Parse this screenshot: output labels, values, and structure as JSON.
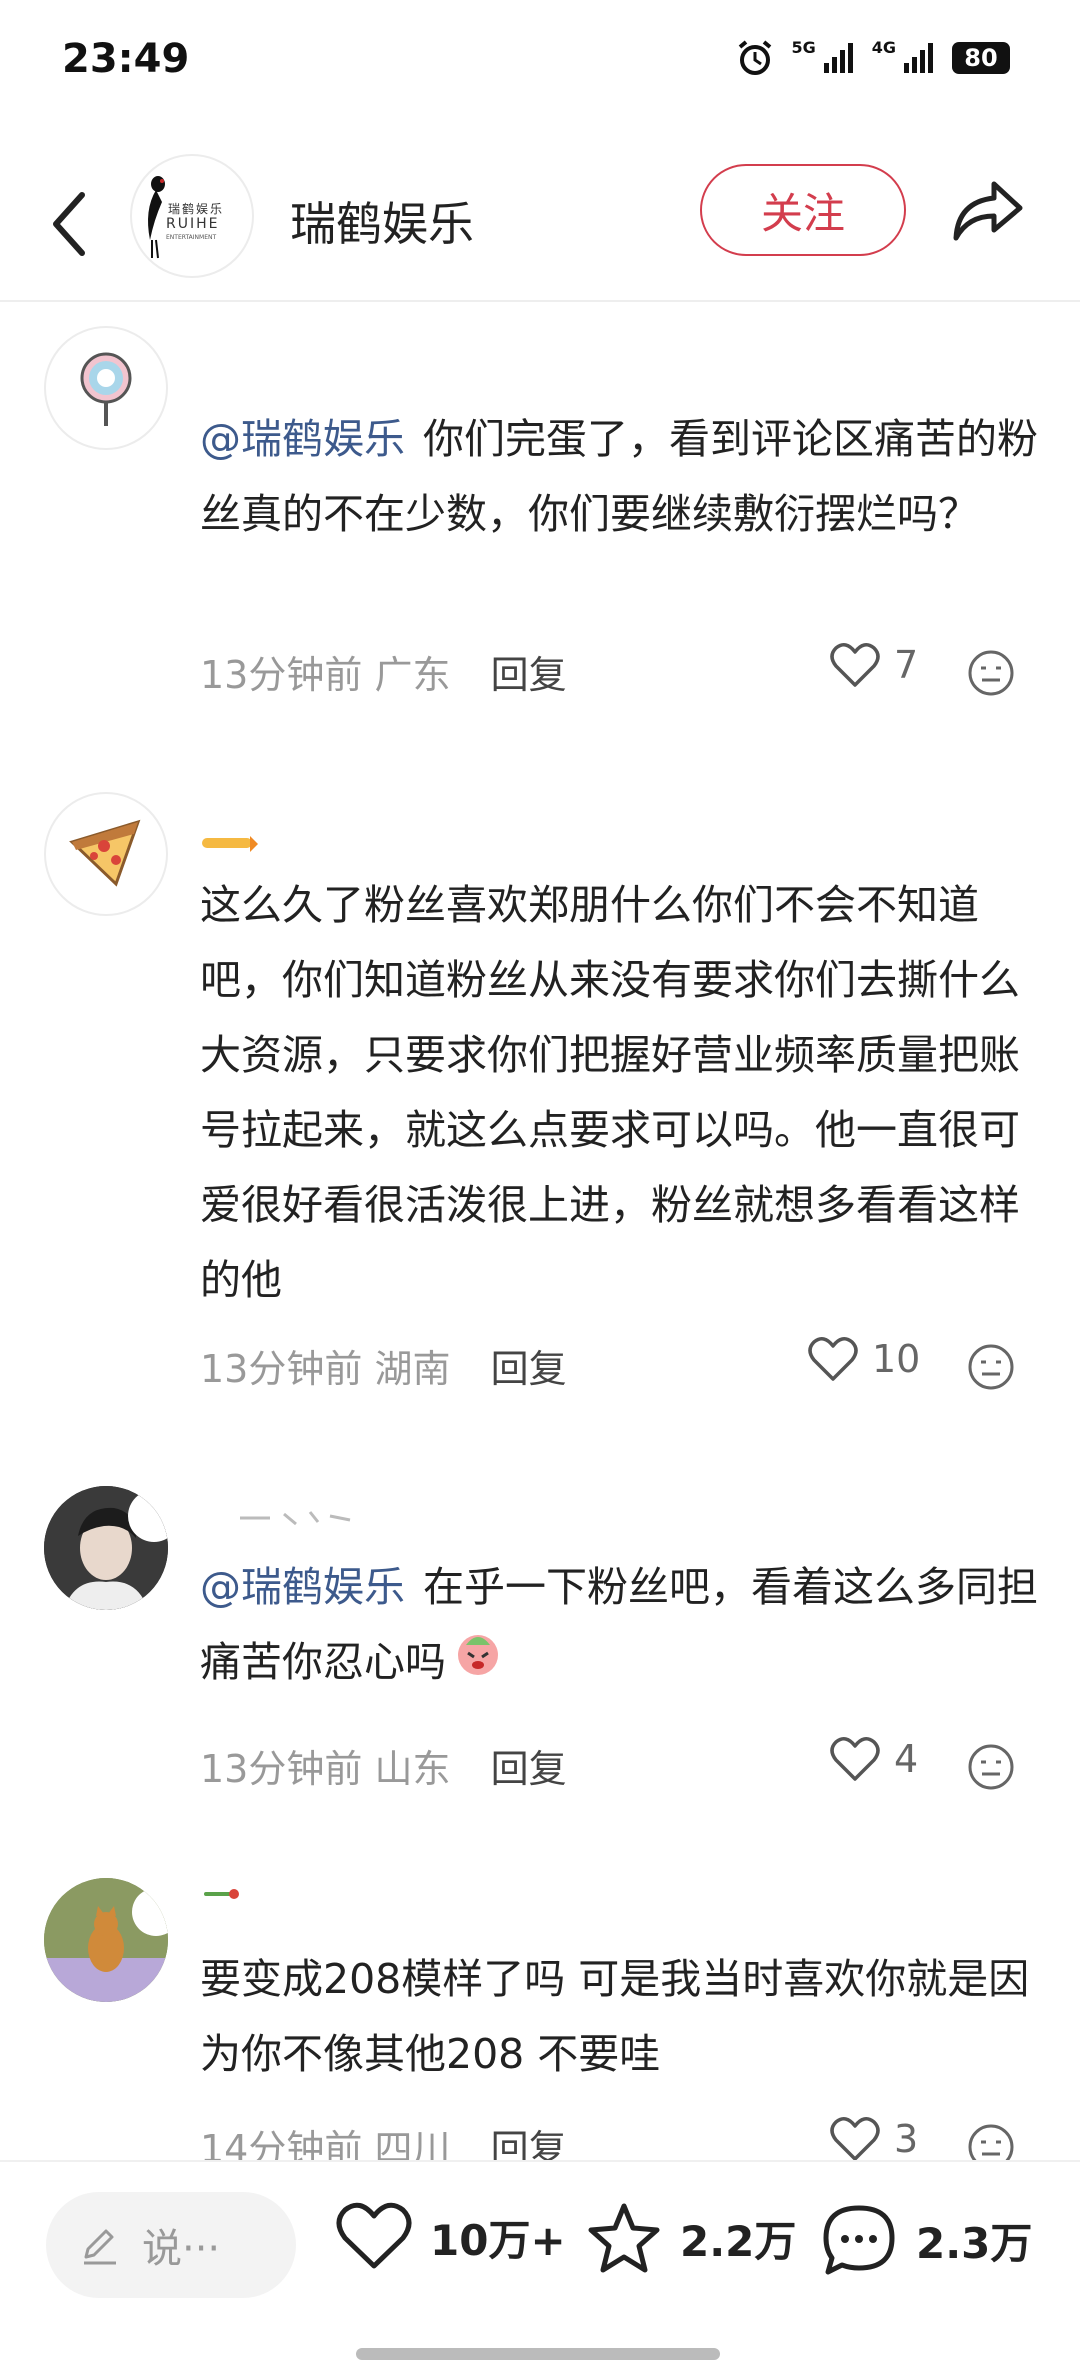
{
  "status_bar": {
    "time": "23:49",
    "net_5g": "5G",
    "net_4g": "4G",
    "battery": "80"
  },
  "header": {
    "back_icon": "chevron-left-icon",
    "logo_cn": "瑞鹤娱乐",
    "logo_en": "RUIHE",
    "logo_en_sub": "ENTERTAINMENT",
    "title": "瑞鹤娱乐",
    "follow_label": "关注",
    "share_icon": "share-arrow-icon"
  },
  "comments": [
    {
      "mention": "@瑞鹤娱乐",
      "text": "你们完蛋了，看到评论区痛苦的粉丝真的不在少数，你们要继续敷衍摆烂吗？",
      "time": "13分钟前",
      "location": "广东",
      "reply": "回复",
      "likes": "7"
    },
    {
      "mention": "",
      "text": "这么久了粉丝喜欢郑朋什么你们不会不知道吧，你们知道粉丝从来没有要求你们去撕什么大资源，只要求你们把握好营业频率质量把账号拉起来，就这么点要求可以吗。他一直很可爱很好看很活泼很上进，粉丝就想多看看这样的他",
      "time": "13分钟前",
      "location": "湖南",
      "reply": "回复",
      "likes": "10"
    },
    {
      "mention": "@瑞鹤娱乐",
      "text": "在乎一下粉丝吧，看着这么多同担痛苦你忍心吗",
      "time": "13分钟前",
      "location": "山东",
      "reply": "回复",
      "likes": "4"
    },
    {
      "mention": "",
      "text": "要变成208模样了吗 可是我当时喜欢你就是因为你不像其他208  不要哇",
      "time": "14分钟前",
      "location": "四川",
      "reply": "回复",
      "likes": "3"
    }
  ],
  "bottom_bar": {
    "input_placeholder": "说···",
    "likes": "10万+",
    "favorites": "2.2万",
    "comments": "2.3万"
  },
  "colors": {
    "accent": "#d33d4d",
    "mention": "#3d5a8c",
    "meta": "#999999"
  }
}
